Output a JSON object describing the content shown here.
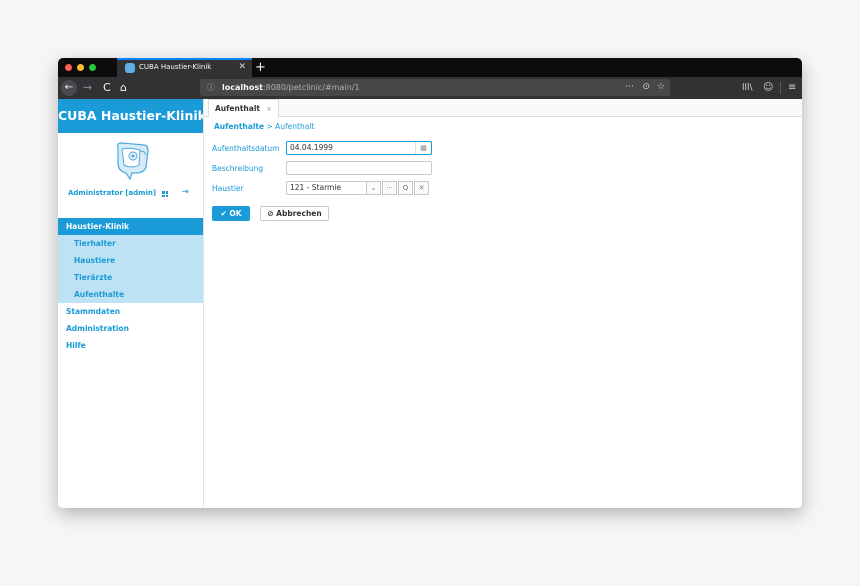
{
  "browser": {
    "tab_title": "CUBA Haustier-Klinik",
    "tab_close": "✕",
    "new_tab": "+",
    "url_host": "localhost",
    "url_rest": ":8080/petclinic/#main/1",
    "icons": {
      "back": "←",
      "forward": "→",
      "reload": "C",
      "home": "⌂",
      "info": "ⓘ",
      "more": "···",
      "pocket": "⊙",
      "star": "☆",
      "library": "lll\\",
      "account": "☺",
      "menu": "≡"
    }
  },
  "app": {
    "title": "CUBA Haustier-Klinik",
    "user": "Administrator [admin]",
    "logout_icon": "⇥",
    "accent_color": "#1a9bd7",
    "menu": {
      "main_label": "Haustier-Klinik",
      "sub_items": [
        "Tierhalter",
        "Haustiere",
        "Tierärzte",
        "Aufenthalte"
      ],
      "other_items": [
        "Stammdaten",
        "Administration",
        "Hilfe"
      ]
    }
  },
  "screen": {
    "tab_label": "Aufenthalt",
    "tab_close": "×",
    "breadcrumb_link": "Aufenthalte",
    "breadcrumb_sep": ">",
    "breadcrumb_current": "Aufenthalt",
    "fields": {
      "date_label": "Aufenthaltsdatum",
      "date_value": "04.04.1999",
      "desc_label": "Beschreibung",
      "desc_value": "",
      "pet_label": "Haustier",
      "pet_value": "121 - Starmie"
    },
    "picker_icons": {
      "calendar": "▦",
      "dropdown": "⌄",
      "lookup": "···",
      "search": "Q",
      "clear": "✕"
    },
    "ok_label": "✔ OK",
    "cancel_label": "⊘ Abbrechen"
  }
}
